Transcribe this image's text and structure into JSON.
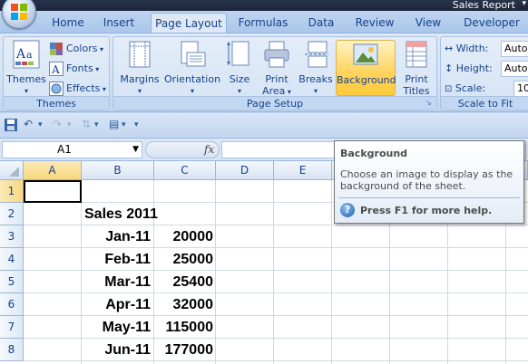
{
  "window": {
    "title": "Sales Report"
  },
  "tabs": [
    "Home",
    "Insert",
    "Page Layout",
    "Formulas",
    "Data",
    "Review",
    "View",
    "Developer"
  ],
  "active_tab": "Page Layout",
  "ribbon": {
    "themes_group": {
      "label": "Themes",
      "themes_button": "Themes",
      "colors": "Colors",
      "fonts": "Fonts",
      "effects": "Effects"
    },
    "page_setup_group": {
      "label": "Page Setup",
      "margins": "Margins",
      "orientation": "Orientation",
      "size": "Size",
      "print_area_1": "Print",
      "print_area_2": "Area",
      "breaks": "Breaks",
      "background": "Background",
      "print_titles_1": "Print",
      "print_titles_2": "Titles"
    },
    "scale_group": {
      "label": "Scale to Fit",
      "width_label": "Width:",
      "width_value": "Auto",
      "height_label": "Height:",
      "height_value": "Auto",
      "scale_label": "Scale:",
      "scale_value": "10"
    }
  },
  "formula_bar": {
    "name_box": "A1",
    "fx": "fx"
  },
  "columns": [
    "A",
    "B",
    "C",
    "D",
    "E"
  ],
  "rows": [
    "1",
    "2",
    "3",
    "4",
    "5",
    "6",
    "7",
    "8"
  ],
  "cells": {
    "title": "Sales 2011",
    "months": [
      "Jan-11",
      "Feb-11",
      "Mar-11",
      "Apr-11",
      "May-11",
      "Jun-11"
    ],
    "values": [
      "20000",
      "25000",
      "25400",
      "32000",
      "115000",
      "177000"
    ]
  },
  "tooltip": {
    "title": "Background",
    "body": "Choose an image to display as the background of the sheet.",
    "help": "Press F1 for more help."
  },
  "colors": {
    "ribbon_bg": "#dfe9f5",
    "highlight": "#ffd35b",
    "header_sel": "#f9d77d"
  }
}
